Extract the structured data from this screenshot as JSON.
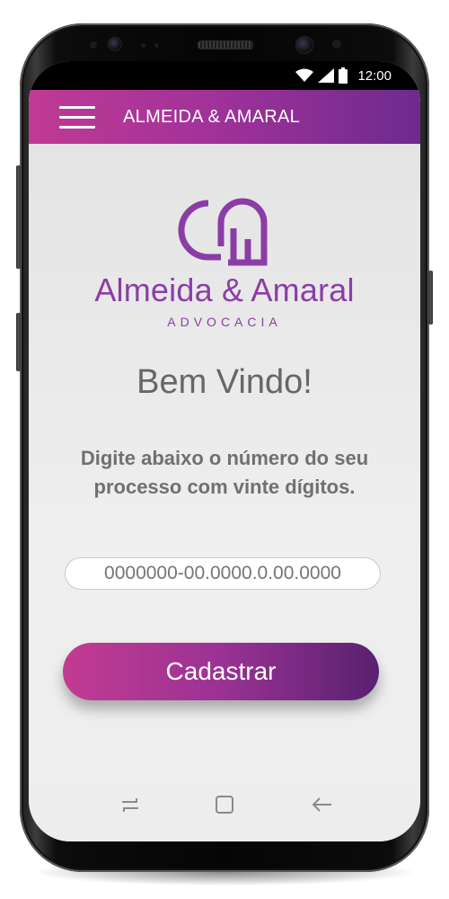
{
  "status": {
    "time": "12:00"
  },
  "appbar": {
    "title": "ALMEIDA & AMARAL"
  },
  "brand": {
    "name": "Almeida & Amaral",
    "subtitle": "ADVOCACIA"
  },
  "main": {
    "welcome": "Bem Vindo!",
    "instruction": "Digite abaixo o número do seu processo com vinte dígitos.",
    "process_field": {
      "placeholder": "0000000-00.0000.0.00.0000",
      "value": ""
    },
    "register_label": "Cadastrar"
  },
  "navigation": {
    "icons": [
      "recent-apps-icon",
      "home-icon",
      "back-icon"
    ]
  },
  "colors": {
    "brand_purple": "#8b3da6",
    "gradient_start": "#c23b92",
    "gradient_end": "#58216f",
    "background": "#ebebeb"
  }
}
